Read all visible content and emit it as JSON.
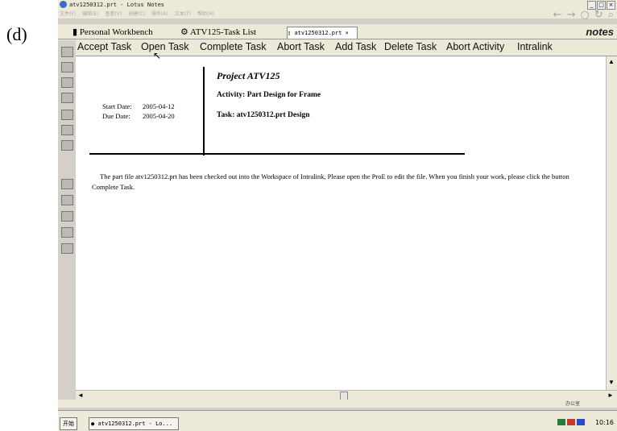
{
  "panel_label": "(d)",
  "window": {
    "title": "atv1250312.prt - Lotus Notes",
    "controls": [
      "_",
      "□",
      "×"
    ]
  },
  "menu": [
    "文件(F)",
    "编辑(E)",
    "查看(V)",
    "创建(C)",
    "操作(A)",
    "文本(T)",
    "帮助(H)"
  ],
  "tabs": [
    {
      "label": "Personal Workbench",
      "icon": "workbench-icon"
    },
    {
      "label": "ATV125-Task List",
      "icon": "task-list-icon"
    },
    {
      "label": "atv1250312.prt",
      "icon": "document-icon",
      "close": "×"
    }
  ],
  "brand": "notes",
  "actions": [
    "Accept Task",
    "Open Task",
    "Complete Task",
    "Abort Task",
    "Add Task",
    "Delete Task",
    "Abort Activity",
    "Intralink"
  ],
  "document": {
    "project": "Project ATV125",
    "activity": "Activity: Part Design for Frame",
    "task": "Task: atv1250312.prt Design",
    "start_date_label": "Start Date:",
    "start_date": "2005-04-12",
    "due_date_label": "Due Date:",
    "due_date": "2005-04-20",
    "message": "The part file atv1250312.prt has been checked out into the Workspace of Intralink, Please open the ProE to edit the file. When you finish your work, please click the button Complete Task."
  },
  "statusbar": {
    "office": "办公室"
  },
  "taskbar": {
    "start": "开始",
    "task_button": "atv1250312.prt - Lo...",
    "clock": "10:16"
  },
  "colors": {
    "chrome": "#ece9d8",
    "content": "#ffffff"
  }
}
